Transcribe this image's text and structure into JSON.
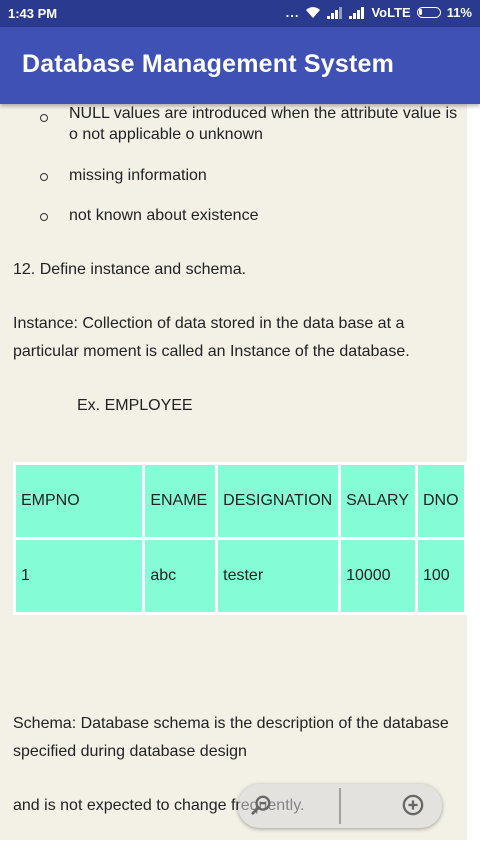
{
  "status_bar": {
    "time": "1:43 PM",
    "dots": "...",
    "network": "VoLTE",
    "battery": "11%"
  },
  "app_bar": {
    "title": "Database Management System"
  },
  "content": {
    "bullets": [
      "NULL values are introduced when the attribute value is o not applicable o unknown",
      "missing information",
      "not known about existence"
    ],
    "question": "12. Define instance and schema.",
    "instance_text": "Instance: Collection of data stored in the data base at a particular moment is called an Instance of the database.",
    "example_label": "Ex. EMPLOYEE",
    "table": {
      "headers": [
        "EMPNO",
        "ENAME",
        "DESIGNATION",
        "SALARY",
        "DNO"
      ],
      "rows": [
        [
          "1",
          "abc",
          "tester",
          "10000",
          "100"
        ]
      ]
    },
    "schema_text": "Schema: Database schema is the description of the database specified during database design",
    "last_line": "and is not expected to change frequently."
  },
  "zoom_control": {
    "zoom_out_icon": "zoom-out-icon",
    "zoom_in_icon": "zoom-in-icon"
  }
}
